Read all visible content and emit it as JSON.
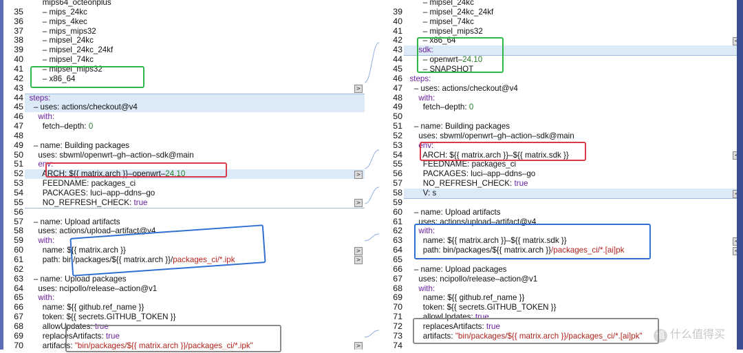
{
  "left": {
    "lines": [
      {
        "n": "",
        "t": "        mips64_octeonplus",
        "cls": ""
      },
      {
        "n": "35",
        "t": "        – mips_24kc"
      },
      {
        "n": "36",
        "t": "        – mips_4kec"
      },
      {
        "n": "37",
        "t": "        – mips_mips32"
      },
      {
        "n": "38",
        "t": "        – mipsel_24kc"
      },
      {
        "n": "39",
        "t": "        – mipsel_24kc_24kf"
      },
      {
        "n": "40",
        "t": "        – mipsel_74kc"
      },
      {
        "n": "41",
        "t": "        – mipsel_mips32"
      },
      {
        "n": "42",
        "t": "        – x86_64"
      },
      {
        "n": "43",
        "t": ""
      },
      {
        "n": "44",
        "t": "  steps:"
      },
      {
        "n": "45",
        "t": "    – uses: actions/checkout@v4"
      },
      {
        "n": "46",
        "t": "      with:"
      },
      {
        "n": "47",
        "t": "        fetch–depth: 0"
      },
      {
        "n": "48",
        "t": ""
      },
      {
        "n": "49",
        "t": "    – name: Building packages"
      },
      {
        "n": "50",
        "t": "      uses: sbwml/openwrt–gh–action–sdk@main"
      },
      {
        "n": "51",
        "t": "      env:"
      },
      {
        "n": "52",
        "t": "        ARCH: ${{ matrix.arch }}–openwrt–24.10"
      },
      {
        "n": "53",
        "t": "        FEEDNAME: packages_ci"
      },
      {
        "n": "54",
        "t": "        PACKAGES: luci–app–ddns–go"
      },
      {
        "n": "55",
        "t": "        NO_REFRESH_CHECK: true"
      },
      {
        "n": "56",
        "t": ""
      },
      {
        "n": "57",
        "t": "    – name: Upload artifacts"
      },
      {
        "n": "58",
        "t": "      uses: actions/upload–artifact@v4"
      },
      {
        "n": "59",
        "t": "      with:"
      },
      {
        "n": "60",
        "t": "        name: ${{ matrix.arch }}"
      },
      {
        "n": "61",
        "t": "        path: bin/packages/${{ matrix.arch }}/packages_ci/*.ipk"
      },
      {
        "n": "62",
        "t": ""
      },
      {
        "n": "63",
        "t": "    – name: Upload packages"
      },
      {
        "n": "64",
        "t": "      uses: ncipollo/release–action@v1"
      },
      {
        "n": "65",
        "t": "      with:"
      },
      {
        "n": "66",
        "t": "        name: ${{ github.ref_name }}"
      },
      {
        "n": "67",
        "t": "        token: ${{ secrets.GITHUB_TOKEN }}"
      },
      {
        "n": "68",
        "t": "        allowUpdates: true"
      },
      {
        "n": "69",
        "t": "        replacesArtifacts: true"
      },
      {
        "n": "70",
        "t": "        artifacts: \"bin/packages/${{ matrix.arch }}/packages_ci/*.ipk\""
      }
    ]
  },
  "right": {
    "lines": [
      {
        "n": "",
        "t": "        – mipsel_24kc"
      },
      {
        "n": "39",
        "t": "        – mipsel_24kc_24kf"
      },
      {
        "n": "40",
        "t": "        – mipsel_74kc"
      },
      {
        "n": "41",
        "t": "        – mipsel_mips32"
      },
      {
        "n": "42",
        "t": "        – x86_64"
      },
      {
        "n": "43",
        "t": "      sdk:"
      },
      {
        "n": "44",
        "t": "        – openwrt–24.10"
      },
      {
        "n": "45",
        "t": "        – SNAPSHOT"
      },
      {
        "n": "46",
        "t": "  steps:"
      },
      {
        "n": "47",
        "t": "    – uses: actions/checkout@v4"
      },
      {
        "n": "48",
        "t": "      with:"
      },
      {
        "n": "49",
        "t": "        fetch–depth: 0"
      },
      {
        "n": "50",
        "t": ""
      },
      {
        "n": "51",
        "t": "    – name: Building packages"
      },
      {
        "n": "52",
        "t": "      uses: sbwml/openwrt–gh–action–sdk@main"
      },
      {
        "n": "53",
        "t": "      env:"
      },
      {
        "n": "54",
        "t": "        ARCH: ${{ matrix.arch }}–${{ matrix.sdk }}"
      },
      {
        "n": "55",
        "t": "        FEEDNAME: packages_ci"
      },
      {
        "n": "56",
        "t": "        PACKAGES: luci–app–ddns–go"
      },
      {
        "n": "57",
        "t": "        NO_REFRESH_CHECK: true"
      },
      {
        "n": "58",
        "t": "        V: s"
      },
      {
        "n": "59",
        "t": ""
      },
      {
        "n": "60",
        "t": "    – name: Upload artifacts"
      },
      {
        "n": "61",
        "t": "      uses: actions/upload–artifact@v4"
      },
      {
        "n": "62",
        "t": "      with:"
      },
      {
        "n": "63",
        "t": "        name: ${{ matrix.arch }}–${{ matrix.sdk }}"
      },
      {
        "n": "64",
        "t": "        path: bin/packages/${{ matrix.arch }}/packages_ci/*.[ai]pk"
      },
      {
        "n": "65",
        "t": ""
      },
      {
        "n": "66",
        "t": "    – name: Upload packages"
      },
      {
        "n": "67",
        "t": "      uses: ncipollo/release–action@v1"
      },
      {
        "n": "68",
        "t": "      with:"
      },
      {
        "n": "69",
        "t": "        name: ${{ github.ref_name }}"
      },
      {
        "n": "70",
        "t": "        token: ${{ secrets.GITHUB_TOKEN }}"
      },
      {
        "n": "71",
        "t": "        allowUpdates: true"
      },
      {
        "n": "72",
        "t": "        replacesArtifacts: true"
      },
      {
        "n": "73",
        "t": "        artifacts: \"bin/packages/${{ matrix.arch }}/packages_ci/*.[ai]pk\""
      },
      {
        "n": "74",
        "t": ""
      }
    ]
  },
  "merge_arrow_left": ">",
  "merge_arrow_right": "<",
  "watermark": {
    "badge": "值",
    "text": "什么值得买"
  },
  "colors": {
    "highlight_row": "#dce9f7",
    "box_green": "#2fb84a",
    "box_red": "#d83a4a",
    "box_blue": "#2f6fd1",
    "box_gray": "#8a8a8a",
    "keyword": "#6b1f9e",
    "number": "#2a7d2a",
    "string": "#b0231c"
  }
}
